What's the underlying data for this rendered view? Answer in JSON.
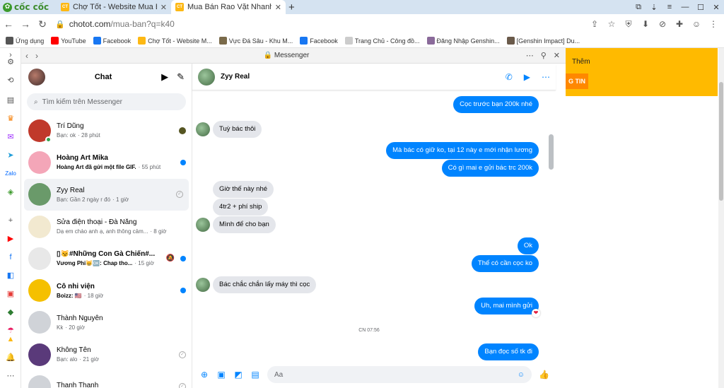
{
  "browser": {
    "brand": "cốc cốc",
    "tabs": [
      {
        "title": "Chợ Tốt - Website Mua Bán..."
      },
      {
        "title": "Mua Bán Rao Vặt Nhanh Chó..."
      }
    ],
    "url_host": "chotot.com",
    "url_path": "/mua-ban?q=k40",
    "bookmarks": [
      {
        "label": "Ứng dụng",
        "color": "#555555"
      },
      {
        "label": "YouTube",
        "color": "#ff0000"
      },
      {
        "label": "Facebook",
        "color": "#1877f2"
      },
      {
        "label": "Chợ Tốt - Website M...",
        "color": "#fdb813"
      },
      {
        "label": "Vực Đá Sâu - Khu M...",
        "color": "#7a6a4a"
      },
      {
        "label": "Facebook",
        "color": "#1877f2"
      },
      {
        "label": "Trang Chủ - Công đồ...",
        "color": "#cccccc"
      },
      {
        "label": "Đăng Nhập Genshin...",
        "color": "#8a6a9a"
      },
      {
        "label": "[Genshin Impact] Du...",
        "color": "#6a5a4a"
      }
    ]
  },
  "messenger": {
    "window_title": "Messenger",
    "list_title": "Chat",
    "search_placeholder": "Tìm kiếm trên Messenger",
    "conversations": [
      {
        "name": "Trí Dũng",
        "preview": "Bạn: ok",
        "time": "· 28 phút",
        "unread": false,
        "avatar_color": "#c0392b",
        "online": true,
        "status": "mini"
      },
      {
        "name": "Hoàng Art Mika",
        "preview": "Hoàng Art đã gửi một file GIF.",
        "time": "· 55 phút",
        "unread": true,
        "avatar_color": "#f4a6b8",
        "status": "dot"
      },
      {
        "name": "Zyy Real",
        "preview": "Bạn: Gần 2 ngày r đó",
        "time": "· 1 giờ",
        "unread": false,
        "avatar_color": "#6a9a6a",
        "status": "seen",
        "selected": true
      },
      {
        "name": "Sửa điện thoại - Đà Nẵng",
        "preview": "Dạ em chào anh ạ, anh thông cảm...",
        "time": "· 8 giờ",
        "unread": false,
        "avatar_color": "#f2e9d0",
        "status": "none"
      },
      {
        "name": "▯😼#Những Con Gà Chiến#...",
        "preview": "Vương Phi😸🆗: Chap tho...",
        "time": "· 15 giờ",
        "unread": true,
        "avatar_color": "#e8e8e8",
        "status": "mute-dot"
      },
      {
        "name": "Cô nhi viện",
        "preview": "Boizz: 🇺🇸",
        "time": "· 18 giờ",
        "unread": true,
        "avatar_color": "#f5c000",
        "status": "dot"
      },
      {
        "name": "Thành Nguyên",
        "preview": "Kk",
        "time": "· 20 giờ",
        "unread": false,
        "avatar_color": "#d0d3d8",
        "status": "none"
      },
      {
        "name": "Không Tên",
        "preview": "Bạn: alo",
        "time": "· 21 giờ",
        "unread": false,
        "avatar_color": "#5a3a7a",
        "status": "seen"
      },
      {
        "name": "Thanh Thanh",
        "preview": "",
        "time": "",
        "unread": false,
        "avatar_color": "#d0d3d8",
        "status": "seen"
      }
    ],
    "thread": {
      "name": "Zyy Real",
      "timestamp": "CN 07:56",
      "composer_placeholder": "Aa",
      "messages": [
        {
          "dir": "out",
          "text": "Cọc trước bạn 200k nhé"
        },
        {
          "dir": "in",
          "text": "Tuỳ bác thôi"
        },
        {
          "dir": "out",
          "text": "Mà bác có giữ ko, tại 12 này e mới nhận lương"
        },
        {
          "dir": "out",
          "text": "Có gì mai e gửi bác trc 200k"
        },
        {
          "dir": "in",
          "text": "Giờ thế này nhé"
        },
        {
          "dir": "in",
          "text": "4tr2 + phí ship"
        },
        {
          "dir": "in",
          "text": "Mình để cho bạn"
        },
        {
          "dir": "out",
          "text": "Ok"
        },
        {
          "dir": "out",
          "text": "Thế có cần cọc ko"
        },
        {
          "dir": "in",
          "text": "Bác chắc chắn lấy máy thì cọc"
        },
        {
          "dir": "out",
          "text": "Uh, mai mình gửi",
          "reaction": "❤"
        },
        {
          "dir": "out",
          "text": "Bạn đọc số tk đi"
        }
      ]
    }
  },
  "page": {
    "more_label": "Thêm",
    "tin_label": "G TIN",
    "accent": "#ffba00"
  }
}
